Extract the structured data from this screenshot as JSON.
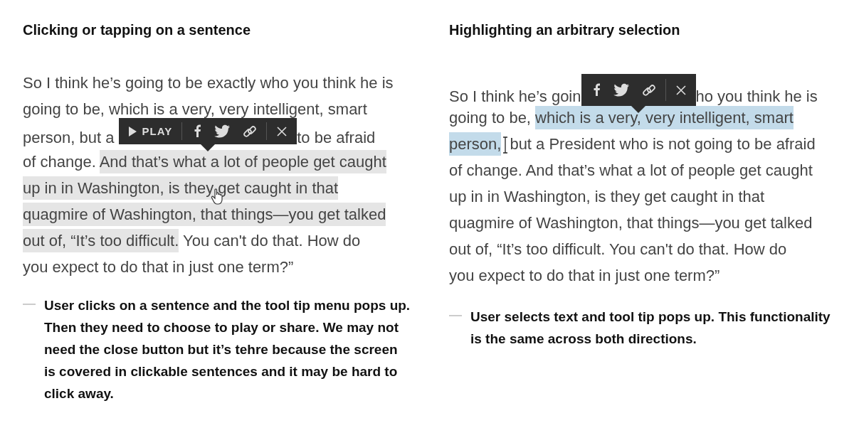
{
  "panels": [
    {
      "title": "Clicking or tapping on a sentence",
      "lines": [
        [
          {
            "kind": "plain",
            "text": "So I think he’s going to be exactly who you think he is"
          }
        ],
        [
          {
            "kind": "plain",
            "text": "going to be, which is a very, very intelligent, smart"
          }
        ],
        [
          {
            "kind": "plain",
            "text": "person, but a "
          },
          {
            "kind": "tooltip"
          },
          {
            "kind": "plain",
            "text": "to be afraid"
          }
        ],
        [
          {
            "kind": "plain",
            "text": "of change. "
          },
          {
            "kind": "sentence",
            "text": "And that’s what a lot of people get caught"
          }
        ],
        [
          {
            "kind": "sentence",
            "text": "up in in Washington, is they "
          },
          {
            "kind": "pointer"
          },
          {
            "kind": "sentence",
            "text": "get caught in that"
          }
        ],
        [
          {
            "kind": "sentence",
            "text": "quagmire of Washington, that things—you get talked"
          }
        ],
        [
          {
            "kind": "sentence",
            "text": "out of, “It’s too difficult."
          },
          {
            "kind": "plain",
            "text": " You can't do that. How do"
          }
        ],
        [
          {
            "kind": "plain",
            "text": "you expect to do that in just one term?”"
          }
        ]
      ],
      "tooltip": {
        "items": [
          {
            "kind": "play",
            "label": "PLAY"
          },
          {
            "kind": "facebook"
          },
          {
            "kind": "twitter"
          },
          {
            "kind": "link"
          },
          {
            "kind": "close"
          }
        ]
      },
      "note": "User clicks on a sentence and the tool tip menu pops up. Then they need to choose to play or share. We may not need the close button but it’s tehre because the screen is covered in clickable sentences and it may be hard to click away."
    },
    {
      "title": "Highlighting an arbitrary selection",
      "lines": [
        [
          {
            "kind": "plain",
            "text": "So I think he’s goin"
          },
          {
            "kind": "tooltip"
          },
          {
            "kind": "plain",
            "text": "ho you think he is"
          }
        ],
        [
          {
            "kind": "plain",
            "text": "going to be, "
          },
          {
            "kind": "selection",
            "text": "which is a very, very intelligent, smart"
          }
        ],
        [
          {
            "kind": "selection",
            "text": "person,"
          },
          {
            "kind": "ibeam"
          },
          {
            "kind": "plain",
            "text": "but a President who is not going to be afraid"
          }
        ],
        [
          {
            "kind": "plain",
            "text": "of change. And that’s what a lot of people get caught"
          }
        ],
        [
          {
            "kind": "plain",
            "text": "up in in Washington, is they get caught in that"
          }
        ],
        [
          {
            "kind": "plain",
            "text": "quagmire of Washington, that things—you get talked"
          }
        ],
        [
          {
            "kind": "plain",
            "text": "out of, “It’s too difficult. You can't do that. How do"
          }
        ],
        [
          {
            "kind": "plain",
            "text": "you expect to do that in just one term?”"
          }
        ]
      ],
      "tooltip": {
        "items": [
          {
            "kind": "facebook"
          },
          {
            "kind": "twitter"
          },
          {
            "kind": "link"
          },
          {
            "kind": "close"
          }
        ]
      },
      "note": "User selects text and tool tip pops up. This functionality is the same across both directions."
    }
  ]
}
